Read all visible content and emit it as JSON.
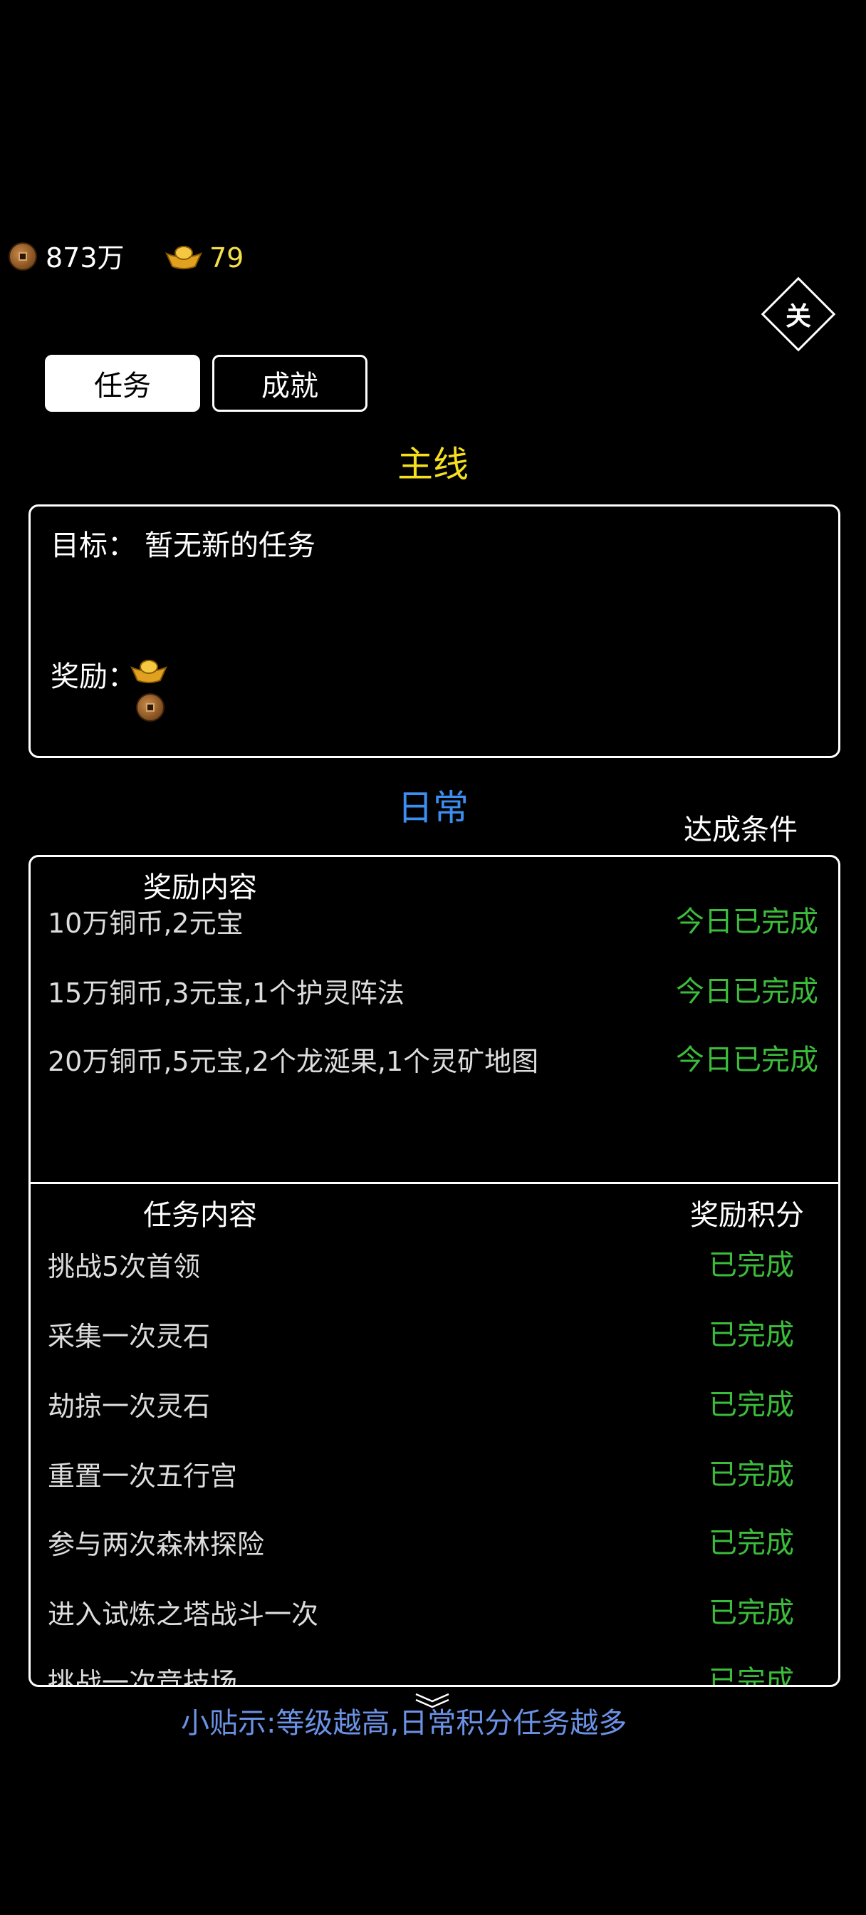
{
  "currency": {
    "copper": "873万",
    "ingot": "79"
  },
  "close_label": "关",
  "tabs": [
    {
      "label": "任务"
    },
    {
      "label": "成就"
    }
  ],
  "mainline": {
    "title": "主线",
    "goal_label": "目标：",
    "goal_value": "暂无新的任务",
    "reward_label": "奖励："
  },
  "daily": {
    "title": "日常",
    "condition_header": "达成条件",
    "reward_header": "奖励内容",
    "rewards": [
      {
        "content": "10万铜币,2元宝",
        "status": "今日已完成"
      },
      {
        "content": "15万铜币,3元宝,1个护灵阵法",
        "status": "今日已完成"
      },
      {
        "content": "20万铜币,5元宝,2个龙涎果,1个灵矿地图",
        "status": "今日已完成"
      }
    ],
    "task_header": "任务内容",
    "points_header": "奖励积分",
    "tasks": [
      {
        "content": "挑战5次首领",
        "status": "已完成"
      },
      {
        "content": "采集一次灵石",
        "status": "已完成"
      },
      {
        "content": "劫掠一次灵石",
        "status": "已完成"
      },
      {
        "content": "重置一次五行宫",
        "status": "已完成"
      },
      {
        "content": "参与两次森林探险",
        "status": "已完成"
      },
      {
        "content": "进入试炼之塔战斗一次",
        "status": "已完成"
      },
      {
        "content": "挑战一次竞技场",
        "status": "已完成"
      }
    ]
  },
  "tip": "小贴示:等级越高,日常积分任务越多"
}
